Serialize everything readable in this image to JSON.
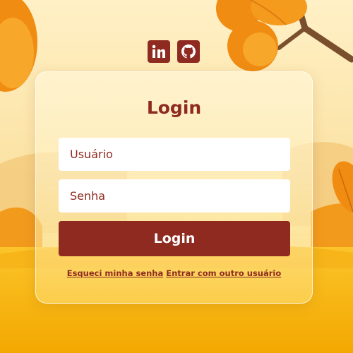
{
  "social": {
    "linkedin_icon": "linkedin-icon",
    "github_icon": "github-icon"
  },
  "login": {
    "title": "Login",
    "username_placeholder": "Usuário",
    "password_placeholder": "Senha",
    "submit_label": "Login",
    "forgot_password_link": "Esqueci minha senha",
    "other_user_link": "Entrar com outro usuário"
  },
  "colors": {
    "accent": "#8e2a20",
    "field_background": "#ffffff",
    "background_sky": "#fdeab0",
    "foliage": "#f08c12"
  }
}
